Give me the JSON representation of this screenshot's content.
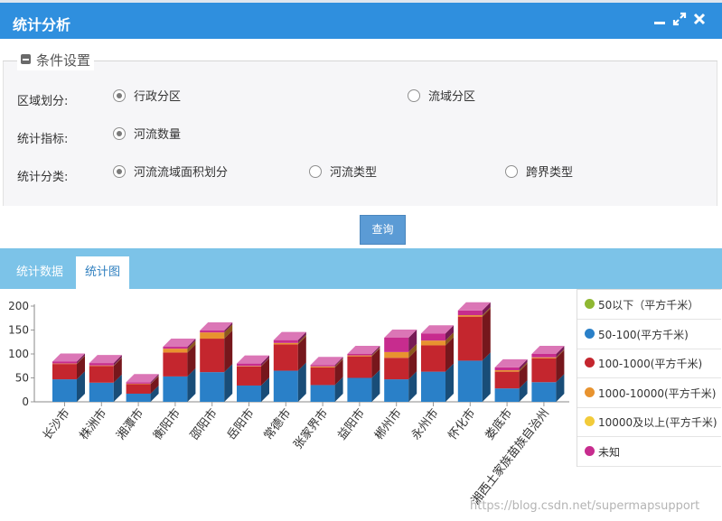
{
  "window": {
    "title": "统计分析"
  },
  "conditions": {
    "legend": "条件设置",
    "region_label": "区域划分:",
    "region_options": [
      "行政分区",
      "流域分区"
    ],
    "index_label": "统计指标:",
    "index_options": [
      "河流数量"
    ],
    "class_label": "统计分类:",
    "class_options": [
      "河流流域面积划分",
      "河流类型",
      "跨界类型"
    ]
  },
  "query_button": "查询",
  "tabs": [
    "统计数据",
    "统计图"
  ],
  "watermark": "https://blog.csdn.net/supermapsupport",
  "colors": {
    "title_bar": "#2f8fde",
    "tab_bar": "#7cc3e8",
    "query_button": "#5b9bd5"
  },
  "chart_data": {
    "type": "bar",
    "stacked": true,
    "ylim": [
      0,
      200
    ],
    "yticks": [
      0,
      50,
      100,
      150,
      200
    ],
    "legend_position": "right",
    "categories": [
      "长沙市",
      "株洲市",
      "湘潭市",
      "衡阳市",
      "邵阳市",
      "岳阳市",
      "常德市",
      "张家界市",
      "益阳市",
      "郴州市",
      "永州市",
      "怀化市",
      "娄底市",
      "湘西土家族苗族自治州"
    ],
    "series": [
      {
        "name": "50以下（平方千米）",
        "color": "#8fb832",
        "values": [
          0,
          0,
          0,
          0,
          0,
          0,
          0,
          0,
          0,
          0,
          0,
          0,
          0,
          0
        ]
      },
      {
        "name": "50-100(平方千米)",
        "color": "#2a80c8",
        "values": [
          47,
          40,
          17,
          53,
          62,
          34,
          65,
          35,
          50,
          47,
          63,
          86,
          28,
          41
        ]
      },
      {
        "name": "100-1000(平方千米)",
        "color": "#c4262e",
        "values": [
          32,
          35,
          20,
          50,
          70,
          40,
          55,
          37,
          45,
          45,
          55,
          92,
          35,
          50
        ]
      },
      {
        "name": "1000-10000(平方千米)",
        "color": "#e8932f",
        "values": [
          1,
          1,
          1,
          8,
          13,
          1,
          3,
          2,
          2,
          12,
          10,
          3,
          3,
          2
        ]
      },
      {
        "name": "10000及以上(平方千米)",
        "color": "#f2cb3a",
        "values": [
          0,
          0,
          0,
          0,
          0,
          0,
          0,
          0,
          0,
          0,
          0,
          0,
          0,
          0
        ]
      },
      {
        "name": "未知",
        "color": "#c72c8e",
        "values": [
          4,
          5,
          3,
          4,
          4,
          5,
          6,
          3,
          3,
          30,
          15,
          10,
          6,
          7
        ]
      }
    ]
  }
}
